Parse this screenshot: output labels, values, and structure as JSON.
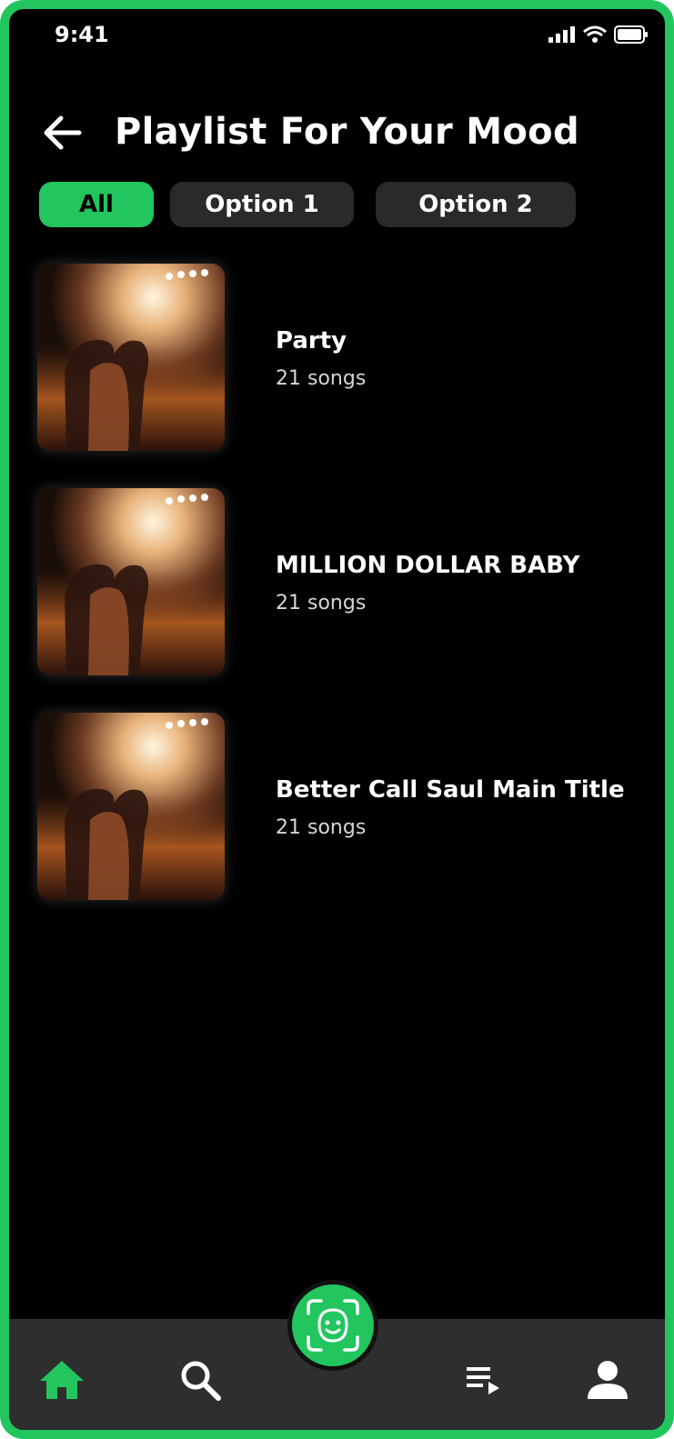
{
  "status_bar": {
    "time": "9:41"
  },
  "header": {
    "title": "Playlist For Your Mood"
  },
  "filters": [
    {
      "label": "All",
      "active": true
    },
    {
      "label": "Option 1",
      "active": false
    },
    {
      "label": "Option 2",
      "active": false
    }
  ],
  "playlists": [
    {
      "title": "Party",
      "subtitle": "21 songs"
    },
    {
      "title": "MILLION DOLLAR BABY",
      "subtitle": "21 songs"
    },
    {
      "title": "Better Call Saul Main Title",
      "subtitle": "21 songs"
    }
  ],
  "bottom_nav": {
    "items": [
      {
        "icon": "home-icon",
        "active": true
      },
      {
        "icon": "search-icon",
        "active": false
      },
      {
        "icon": "face-scan-icon",
        "active": false
      },
      {
        "icon": "queue-icon",
        "active": false
      },
      {
        "icon": "profile-icon",
        "active": false
      }
    ]
  },
  "colors": {
    "accent": "#22c55e",
    "background": "#000000",
    "chip": "#2a2a2a",
    "nav": "#2e2e2e"
  }
}
